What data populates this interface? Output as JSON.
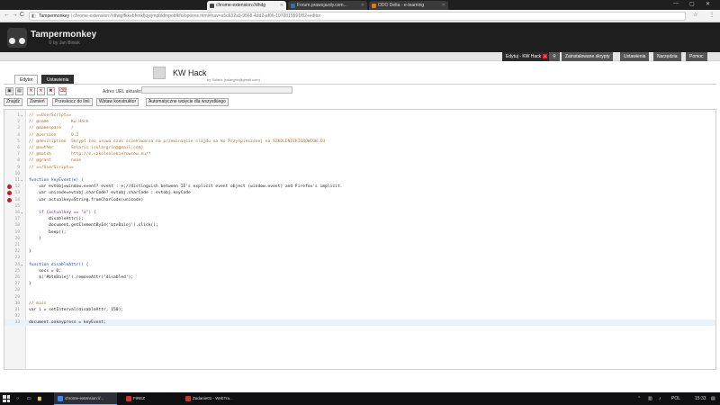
{
  "browser": {
    "tabs": [
      {
        "label": "chrome-extension://dhdg",
        "active": true,
        "fav_color": "#444444"
      },
      {
        "label": "Forum.prawojazdy.com...",
        "active": false,
        "fav_color": "#3a6ea5"
      },
      {
        "label": "ODO Delta - e-learning",
        "active": false,
        "fav_color": "#e07a10"
      }
    ],
    "site": "Tampermonkey",
    "url_path": "chrome-extension://dhdgffkkebhmkfjojejmpbldmpobfkfo/options.html#nav=a5c632a9-9568-4dd2-af06-1072815591f82+editor",
    "back": "←",
    "forward": "→",
    "reload": "C",
    "star": "☆",
    "menu": "⋮"
  },
  "tm": {
    "title": "Tampermonkey",
    "subtitle": "© by Jan Biniok"
  },
  "nav": {
    "tabs": [
      {
        "label": "Edytuj - KW Hack",
        "active": true,
        "closable": true
      },
      {
        "label": "Zainstalowane skrypty",
        "active": false
      },
      {
        "label": "Ustawienia",
        "active": false
      },
      {
        "label": "Narzędzia",
        "active": false
      },
      {
        "label": "Pomoc",
        "active": false
      }
    ]
  },
  "script": {
    "name": "KW Hack",
    "author": "by Solaric (solargrin@gmail.com)"
  },
  "subtabs": {
    "editor": "Edytor",
    "settings": "Ustawienia"
  },
  "toolbar": {
    "url_label": "Adres URL aktualizacji:",
    "url_value": "",
    "actions": [
      "Znajdź",
      "Zamień",
      "Przeskocz do linii",
      "Wstaw konstruktor",
      "Automatyczne wcięcie dla wszystkiego"
    ]
  },
  "code": {
    "lines": [
      {
        "n": "1",
        "t": "// ==UserScript==",
        "k": "com",
        "fold": true
      },
      {
        "n": "2",
        "t": "// @name         Kw Hack",
        "k": "com"
      },
      {
        "n": "3",
        "t": "// @namespace    /",
        "k": "com"
      },
      {
        "n": "4",
        "t": "// @version      0.2",
        "k": "com"
      },
      {
        "n": "5",
        "t": "// @description  Skrypt ten usuwa czas oczekiwania na przewinięcie slajdu na ko Przyśpieszonej na SZKOLENIEKIEROWCOW.EU",
        "k": "com"
      },
      {
        "n": "6",
        "t": "// @author       Solaric (solargrin@gmail.com)",
        "k": "com"
      },
      {
        "n": "7",
        "t": "// @match        http://e.szkoleniekierowcow.eu/*",
        "k": "com"
      },
      {
        "n": "8",
        "t": "// @grant        none",
        "k": "com"
      },
      {
        "n": "9",
        "t": "// ==/UserScript==",
        "k": "com"
      },
      {
        "n": "10",
        "t": "",
        "k": "plain"
      },
      {
        "n": "11",
        "t": "function keyEvent(e) {",
        "k": "fn",
        "fold": true
      },
      {
        "n": "12",
        "t": "    var evtobj=window.event? event : e;//distinguish between IE's explicit event object (window.event) and Firefox's implicit.",
        "k": "plain",
        "err": true
      },
      {
        "n": "13",
        "t": "    var unicode=evtobj.charCode? evtobj.charCode : evtobj.keyCode",
        "k": "plain",
        "err": true
      },
      {
        "n": "14",
        "t": "    var actualkey=String.fromCharCode(unicode)",
        "k": "plain",
        "err": true
      },
      {
        "n": "15",
        "t": "",
        "k": "plain"
      },
      {
        "n": "16",
        "t": "    if (actualkey == \"a\") {",
        "k": "kw",
        "fold": true
      },
      {
        "n": "17",
        "t": "        disableAttr();",
        "k": "plain"
      },
      {
        "n": "18",
        "t": "        document.getElementById('btnDalej').click();",
        "k": "plain"
      },
      {
        "n": "19",
        "t": "        beep();",
        "k": "plain"
      },
      {
        "n": "20",
        "t": "    }",
        "k": "plain"
      },
      {
        "n": "21",
        "t": "",
        "k": "plain"
      },
      {
        "n": "22",
        "t": "}",
        "k": "plain"
      },
      {
        "n": "23",
        "t": "",
        "k": "plain"
      },
      {
        "n": "24",
        "t": "function disableAttr() {",
        "k": "fn",
        "fold": true
      },
      {
        "n": "25",
        "t": "    secs = 0;",
        "k": "plain"
      },
      {
        "n": "26",
        "t": "    $('#btnDalej').removeAttr('disabled');",
        "k": "plain"
      },
      {
        "n": "27",
        "t": "}",
        "k": "plain"
      },
      {
        "n": "28",
        "t": "",
        "k": "plain"
      },
      {
        "n": "29",
        "t": "",
        "k": "plain"
      },
      {
        "n": "30",
        "t": "// main",
        "k": "com"
      },
      {
        "n": "31",
        "t": "var i = setInterval(disableAttr, 150);",
        "k": "plain"
      },
      {
        "n": "32",
        "t": "",
        "k": "plain"
      },
      {
        "n": "33",
        "t": "document.onkeypress = keyEvent;",
        "k": "plain",
        "cur": true
      }
    ]
  },
  "taskbar": {
    "items": [
      {
        "label": "chrome-extension://...",
        "color": "#4285f4",
        "active": true
      },
      {
        "label": "FIREZ",
        "color": "#cc3333",
        "active": false
      },
      {
        "label": "Zadanie01 - WebTra...",
        "color": "#c0392b",
        "active": false
      }
    ],
    "lang": "POL",
    "time": "15:33"
  }
}
